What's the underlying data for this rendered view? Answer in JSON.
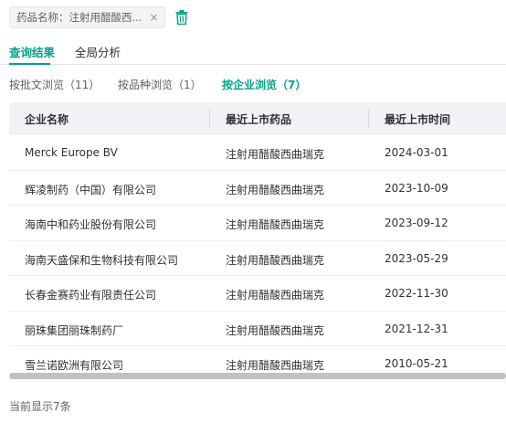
{
  "filter": {
    "chip_label": "药品名称：注射用醋酸西...",
    "close_glyph": "×"
  },
  "main_tabs": [
    {
      "label": "查询结果",
      "active": true
    },
    {
      "label": "全局分析",
      "active": false
    }
  ],
  "sub_tabs": [
    {
      "label": "按批文浏览（11）",
      "active": false
    },
    {
      "label": "按品种浏览（1）",
      "active": false
    },
    {
      "label": "按企业浏览（7）",
      "active": true
    }
  ],
  "table": {
    "headers": [
      "企业名称",
      "最近上市药品",
      "最近上市时间"
    ],
    "rows": [
      [
        "Merck Europe BV",
        "注射用醋酸西曲瑞克",
        "2024-03-01"
      ],
      [
        "辉凌制药（中国）有限公司",
        "注射用醋酸西曲瑞克",
        "2023-10-09"
      ],
      [
        "海南中和药业股份有限公司",
        "注射用醋酸西曲瑞克",
        "2023-09-12"
      ],
      [
        "海南天盛保和生物科技有限公司",
        "注射用醋酸西曲瑞克",
        "2023-05-29"
      ],
      [
        "长春金赛药业有限责任公司",
        "注射用醋酸西曲瑞克",
        "2022-11-30"
      ],
      [
        "丽珠集团丽珠制药厂",
        "注射用醋酸西曲瑞克",
        "2021-12-31"
      ],
      [
        "雪兰诺欧洲有限公司",
        "注射用醋酸西曲瑞克",
        "2010-05-21"
      ]
    ]
  },
  "footer": {
    "count_text": "当前显示7条"
  },
  "colors": {
    "accent": "#00a389",
    "header_bg": "#f0f2f5"
  },
  "icons": {
    "trash": "trash-icon",
    "close": "close-icon"
  }
}
